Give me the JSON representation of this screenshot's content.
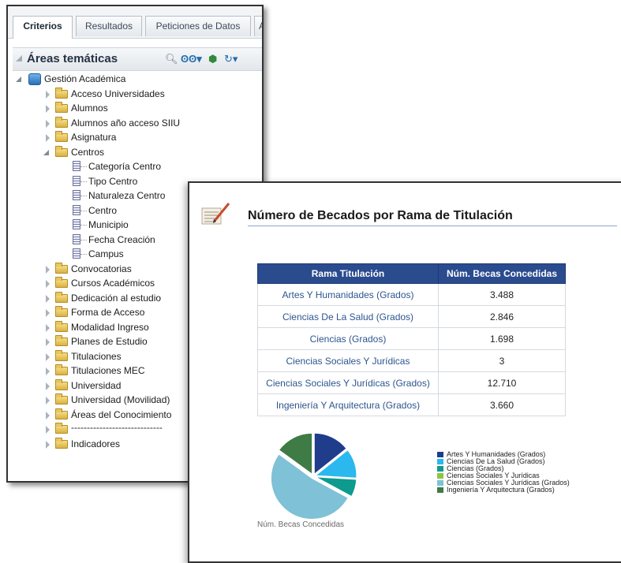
{
  "criteria_panel": {
    "tabs": [
      {
        "label": "Criterios",
        "active": true
      },
      {
        "label": "Resultados",
        "active": false
      },
      {
        "label": "Peticiones de Datos",
        "active": false
      },
      {
        "label": "A",
        "active": false
      }
    ],
    "subjects_title": "Áreas temáticas",
    "toolbar_icons": [
      "search-icon",
      "binoculars-icon",
      "add-subject-icon",
      "refresh-icon"
    ],
    "root": "Gestión Académica",
    "folders_before": [
      "Acceso Universidades",
      "Alumnos",
      "Alumnos año acceso SIIU",
      "Asignatura"
    ],
    "expanded_folder": "Centros",
    "centros_columns": [
      "Categoría Centro",
      "Tipo Centro",
      "Naturaleza Centro",
      "Centro",
      "Municipio",
      "Fecha Creación",
      "Campus"
    ],
    "folders_after": [
      "Convocatorias",
      "Cursos Académicos",
      "Dedicación al estudio",
      "Forma de Acceso",
      "Modalidad Ingreso",
      "Planes de Estudio",
      "Titulaciones",
      "Titulaciones MEC",
      "Universidad",
      "Universidad (Movilidad)",
      "Áreas del Conocimiento",
      "-----------------------------",
      "Indicadores"
    ]
  },
  "report": {
    "title": "Número de Becados por Rama de Titulación",
    "table": {
      "headers": [
        "Rama Titulación",
        "Núm. Becas Concedidas"
      ],
      "rows": [
        {
          "rama": "Artes Y Humanidades (Grados)",
          "becas": "3.488"
        },
        {
          "rama": "Ciencias De La Salud (Grados)",
          "becas": "2.846"
        },
        {
          "rama": "Ciencias (Grados)",
          "becas": "1.698"
        },
        {
          "rama": "Ciencias Sociales Y Jurídicas",
          "becas": "3"
        },
        {
          "rama": "Ciencias Sociales Y Jurídicas (Grados)",
          "becas": "12.710"
        },
        {
          "rama": "Ingeniería Y Arquitectura (Grados)",
          "becas": "3.660"
        }
      ]
    },
    "pie_caption": "Núm. Becas Concedidas"
  },
  "chart_data": {
    "type": "pie",
    "categories": [
      "Artes Y Humanidades (Grados)",
      "Ciencias De La Salud (Grados)",
      "Ciencias (Grados)",
      "Ciencias Sociales Y Jurídicas",
      "Ciencias Sociales Y Jurídicas (Grados)",
      "Ingeniería Y Arquitectura (Grados)"
    ],
    "values": [
      3488,
      2846,
      1698,
      3,
      12710,
      3660
    ],
    "colors": [
      "#1f3d8a",
      "#2bb8ee",
      "#0f9a8e",
      "#8cc63e",
      "#7fc1d6",
      "#3e7b45"
    ],
    "title": "",
    "legend_position": "right"
  }
}
